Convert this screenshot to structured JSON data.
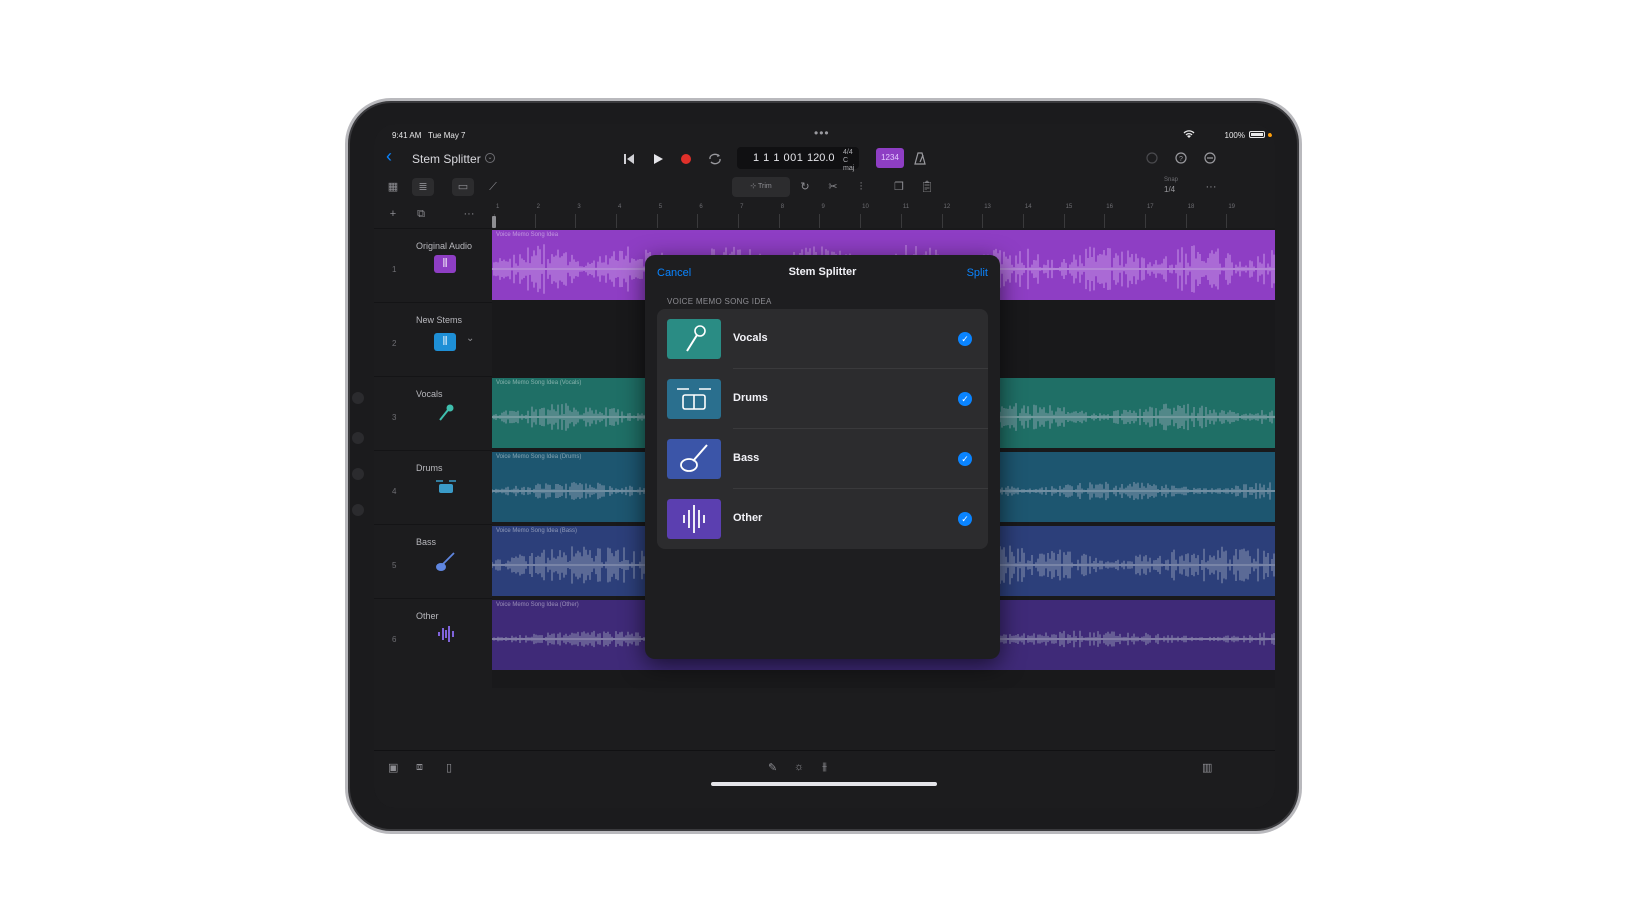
{
  "status_bar": {
    "time": "9:41 AM",
    "date": "Tue May 7",
    "battery": "100%"
  },
  "header": {
    "project_title": "Stem Splitter",
    "lcd": {
      "position": "1 1 1 001",
      "tempo": "120.0",
      "time_signature": "4/4",
      "key": "C maj"
    },
    "count_in": "1234"
  },
  "toolbar": {
    "trim_label": "Trim",
    "snap_label": "Snap",
    "snap_value": "1/4"
  },
  "ruler": {
    "bars": [
      "1",
      "2",
      "3",
      "4",
      "5",
      "6",
      "7",
      "8",
      "9",
      "10",
      "11",
      "12",
      "13",
      "14",
      "15",
      "16",
      "17",
      "18",
      "19"
    ]
  },
  "tracks": [
    {
      "number": "1",
      "name": "Original Audio",
      "region": "Voice Memo Song Idea",
      "color": "#8e3ec4"
    },
    {
      "number": "2",
      "name": "New Stems",
      "region": "",
      "color": "#1e8fd6"
    },
    {
      "number": "3",
      "name": "Vocals",
      "region": "Voice Memo Song Idea (Vocals)",
      "color": "#1f6f66"
    },
    {
      "number": "4",
      "name": "Drums",
      "region": "Voice Memo Song Idea (Drums)",
      "color": "#1d5670"
    },
    {
      "number": "5",
      "name": "Bass",
      "region": "Voice Memo Song Idea (Bass)",
      "color": "#2c3f7a"
    },
    {
      "number": "6",
      "name": "Other",
      "region": "Voice Memo Song Idea (Other)",
      "color": "#3f2a78"
    }
  ],
  "modal": {
    "cancel_label": "Cancel",
    "title": "Stem Splitter",
    "split_label": "Split",
    "section_label": "VOICE MEMO SONG IDEA",
    "stems": [
      {
        "label": "Vocals",
        "icon": "microphone-icon",
        "color": "#2a8c84",
        "checked": true
      },
      {
        "label": "Drums",
        "icon": "drum-kit-icon",
        "color": "#2a6f8e",
        "checked": true
      },
      {
        "label": "Bass",
        "icon": "bass-guitar-icon",
        "color": "#3b55a8",
        "checked": true
      },
      {
        "label": "Other",
        "icon": "waveform-icon",
        "color": "#5b3fb0",
        "checked": true
      }
    ]
  },
  "colors": {
    "accent": "#0a84ff",
    "background": "#1c1c1e"
  }
}
